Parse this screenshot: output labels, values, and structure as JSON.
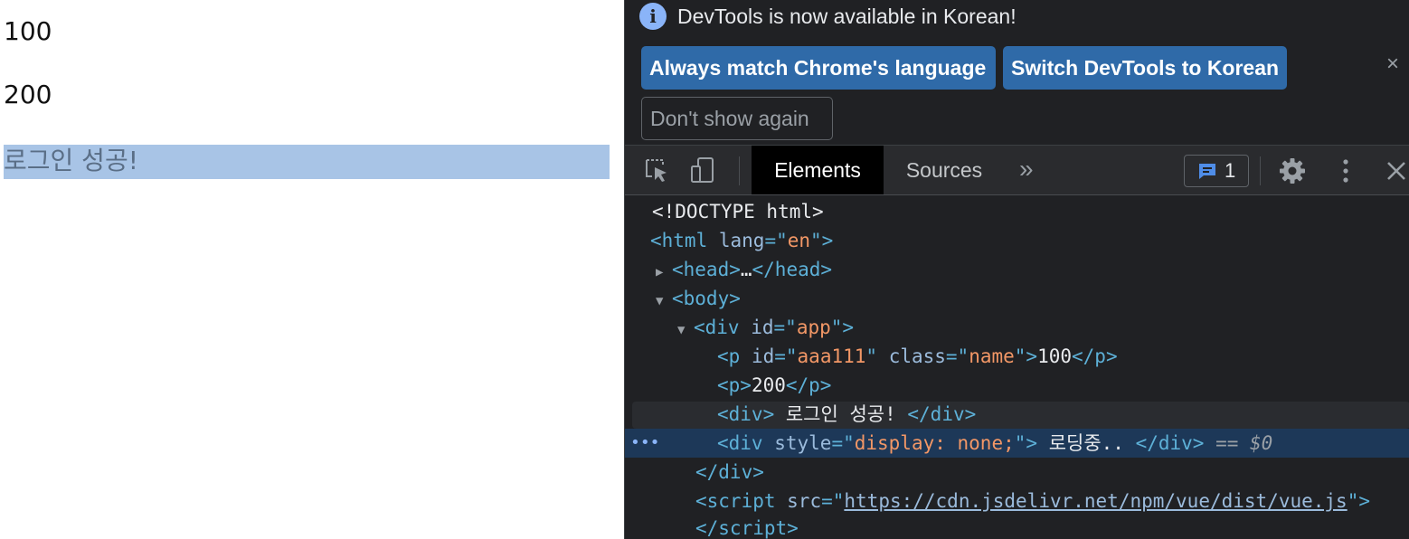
{
  "page": {
    "lines": [
      "100",
      "200"
    ],
    "login_message": "로그인 성공!"
  },
  "devtools": {
    "infobar": {
      "icon": "info-icon",
      "message": "DevTools is now available in Korean!",
      "buttons": {
        "match_language": "Always match Chrome's language",
        "switch_korean": "Switch DevTools to Korean",
        "dont_show": "Don't show again"
      },
      "close": "×"
    },
    "toolbar": {
      "tabs": [
        "Elements",
        "Sources"
      ],
      "active_tab": "Elements",
      "more_tabs": "»",
      "issues_count": "1",
      "icons": [
        "inspect-icon",
        "device-toggle-icon",
        "issues-icon",
        "gear-icon",
        "kebab-icon",
        "close-icon"
      ]
    },
    "dom": {
      "doctype": "<!DOCTYPE html>",
      "html_lang": "en",
      "div_app_id": "app",
      "p1_id": "aaa111",
      "p1_class": "name",
      "p1_text": "100",
      "p2_text": "200",
      "div_login_text": " 로그인 성공! ",
      "div_loading_style": "display: none;",
      "div_loading_text": " 로딩중.. ",
      "selected_marker": "== $0",
      "script_src": "https://cdn.jsdelivr.net/npm/vue/dist/vue.js"
    },
    "colors": {
      "background": "#202124",
      "tag": "#5db0d7",
      "attr_value": "#f29766",
      "button_blue": "#2f6aa8",
      "selected_row": "#1d3858"
    }
  }
}
